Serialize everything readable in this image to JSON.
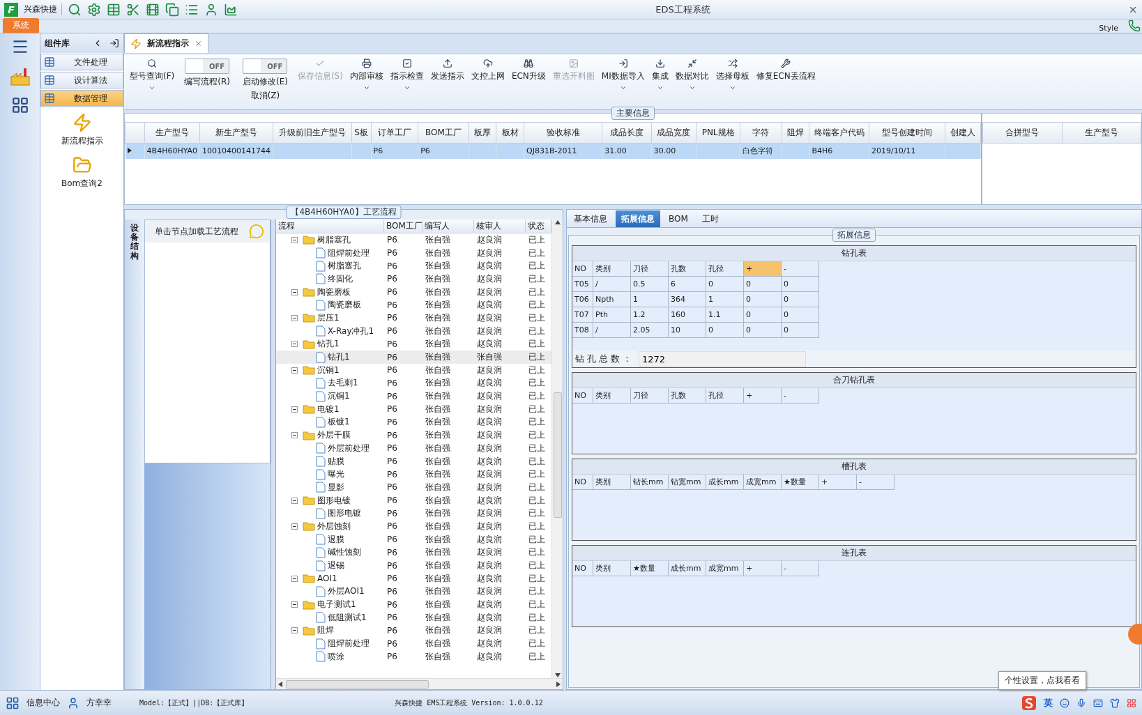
{
  "app": {
    "logo_letter": "F",
    "quick_label": "兴森快捷",
    "title": "EDS工程系统",
    "ribbon_tab": "系统",
    "style_menu": "Style"
  },
  "components": {
    "title": "组件库",
    "items": [
      {
        "label": "文件处理",
        "selected": false
      },
      {
        "label": "设计算法",
        "selected": false
      },
      {
        "label": "数据管理",
        "selected": true
      }
    ],
    "launchers": [
      {
        "label": "新流程指示"
      },
      {
        "label": "Bom查询2"
      }
    ]
  },
  "doc_tab": {
    "label": "新流程指示"
  },
  "toolbar": {
    "items": [
      {
        "kind": "button",
        "label": "型号查询(F)",
        "disabled": false,
        "dropdown": true
      },
      {
        "kind": "toggle",
        "label": "编写流程(R)",
        "switch_text": "OFF",
        "on": false
      },
      {
        "kind": "toggle",
        "label": "启动修改(E)",
        "sub_label": "取消(Z)",
        "switch_text": "OFF",
        "on": false
      },
      {
        "kind": "button",
        "label": "保存信息(S)",
        "disabled": true,
        "dropdown": false
      },
      {
        "kind": "button",
        "label": "内部审核",
        "disabled": false,
        "dropdown": true
      },
      {
        "kind": "button",
        "label": "指示检查",
        "disabled": false,
        "dropdown": true
      },
      {
        "kind": "button",
        "label": "发送指示",
        "disabled": false,
        "dropdown": false
      },
      {
        "kind": "button",
        "label": "文控上网",
        "disabled": false,
        "dropdown": false
      },
      {
        "kind": "button",
        "label": "ECN升级",
        "disabled": false,
        "dropdown": false
      },
      {
        "kind": "button",
        "label": "重选开料图",
        "disabled": true,
        "dropdown": false
      },
      {
        "kind": "button",
        "label": "MI数据导入",
        "disabled": false,
        "dropdown": true
      },
      {
        "kind": "button",
        "label": "集成",
        "disabled": false,
        "dropdown": true
      },
      {
        "kind": "button",
        "label": "数据对比",
        "disabled": false,
        "dropdown": true
      },
      {
        "kind": "button",
        "label": "选择母板",
        "disabled": false,
        "dropdown": true
      },
      {
        "kind": "button",
        "label": "修复ECN丢流程",
        "disabled": false,
        "dropdown": false
      }
    ]
  },
  "main_info": {
    "title": "主要信息",
    "columns": [
      "生产型号",
      "新生产型号",
      "升级前旧生产型号",
      "S板",
      "订单工厂",
      "BOM工厂",
      "板厚",
      "板材",
      "验收标准",
      "成品长度",
      "成品宽度",
      "PNL规格",
      "字符",
      "阻焊",
      "终端客户代码",
      "型号创建时间",
      "创建人"
    ],
    "rows": [
      {
        "selected": true,
        "cells": [
          "4B4H60HYA0",
          "10010400141744",
          "",
          "",
          "P6",
          "P6",
          "",
          "",
          "QJ831B-2011",
          "31.00",
          "30.00",
          "",
          "白色字符",
          "",
          "B4H6",
          "2019/10/11",
          ""
        ]
      }
    ],
    "side_columns": [
      "合拼型号",
      "生产型号"
    ]
  },
  "side_tab": {
    "label": "设备结构"
  },
  "node_panel": {
    "hint": "单击节点加载工艺流程"
  },
  "flow": {
    "title": "【4B4H60HYA0】工艺流程",
    "columns": [
      "流程",
      "BOM工厂",
      "编写人",
      "核审人",
      "状态"
    ],
    "nodes": [
      {
        "name": "树脂塞孔",
        "bom": "P6",
        "writer": "张自强",
        "reviewer": "赵良润",
        "status": "已上",
        "selected": false,
        "expanded": true,
        "children": [
          {
            "name": "阻焊前处理",
            "bom": "P6",
            "writer": "张自强",
            "reviewer": "赵良润",
            "status": "已上",
            "selected": false
          },
          {
            "name": "树脂塞孔",
            "bom": "P6",
            "writer": "张自强",
            "reviewer": "赵良润",
            "status": "已上",
            "selected": false
          },
          {
            "name": "终固化",
            "bom": "P6",
            "writer": "张自强",
            "reviewer": "赵良润",
            "status": "已上",
            "selected": false
          }
        ]
      },
      {
        "name": "陶瓷磨板",
        "bom": "P6",
        "writer": "张自强",
        "reviewer": "赵良润",
        "status": "已上",
        "selected": false,
        "expanded": true,
        "children": [
          {
            "name": "陶瓷磨板",
            "bom": "P6",
            "writer": "张自强",
            "reviewer": "赵良润",
            "status": "已上",
            "selected": false
          }
        ]
      },
      {
        "name": "层压1",
        "bom": "P6",
        "writer": "张自强",
        "reviewer": "赵良润",
        "status": "已上",
        "selected": false,
        "expanded": true,
        "children": [
          {
            "name": "X-Ray冲孔1",
            "bom": "P6",
            "writer": "张自强",
            "reviewer": "赵良润",
            "status": "已上",
            "selected": false
          }
        ]
      },
      {
        "name": "钻孔1",
        "bom": "P6",
        "writer": "张自强",
        "reviewer": "赵良润",
        "status": "已上",
        "selected": false,
        "expanded": true,
        "children": [
          {
            "name": "钻孔1",
            "bom": "P6",
            "writer": "张自强",
            "reviewer": "张自强",
            "status": "已上",
            "selected": true
          }
        ]
      },
      {
        "name": "沉铜1",
        "bom": "P6",
        "writer": "张自强",
        "reviewer": "赵良润",
        "status": "已上",
        "selected": false,
        "expanded": true,
        "children": [
          {
            "name": "去毛刺1",
            "bom": "P6",
            "writer": "张自强",
            "reviewer": "赵良润",
            "status": "已上",
            "selected": false
          },
          {
            "name": "沉铜1",
            "bom": "P6",
            "writer": "张自强",
            "reviewer": "赵良润",
            "status": "已上",
            "selected": false
          }
        ]
      },
      {
        "name": "电镀1",
        "bom": "P6",
        "writer": "张自强",
        "reviewer": "赵良润",
        "status": "已上",
        "selected": false,
        "expanded": true,
        "children": [
          {
            "name": "板镀1",
            "bom": "P6",
            "writer": "张自强",
            "reviewer": "赵良润",
            "status": "已上",
            "selected": false
          }
        ]
      },
      {
        "name": "外层干膜",
        "bom": "P6",
        "writer": "张自强",
        "reviewer": "赵良润",
        "status": "已上",
        "selected": false,
        "expanded": true,
        "children": [
          {
            "name": "外层前处理",
            "bom": "P6",
            "writer": "张自强",
            "reviewer": "赵良润",
            "status": "已上",
            "selected": false
          },
          {
            "name": "贴膜",
            "bom": "P6",
            "writer": "张自强",
            "reviewer": "赵良润",
            "status": "已上",
            "selected": false
          },
          {
            "name": "曝光",
            "bom": "P6",
            "writer": "张自强",
            "reviewer": "赵良润",
            "status": "已上",
            "selected": false
          },
          {
            "name": "显影",
            "bom": "P6",
            "writer": "张自强",
            "reviewer": "赵良润",
            "status": "已上",
            "selected": false
          }
        ]
      },
      {
        "name": "图形电镀",
        "bom": "P6",
        "writer": "张自强",
        "reviewer": "赵良润",
        "status": "已上",
        "selected": false,
        "expanded": true,
        "children": [
          {
            "name": "图形电镀",
            "bom": "P6",
            "writer": "张自强",
            "reviewer": "赵良润",
            "status": "已上",
            "selected": false
          }
        ]
      },
      {
        "name": "外层蚀刻",
        "bom": "P6",
        "writer": "张自强",
        "reviewer": "赵良润",
        "status": "已上",
        "selected": false,
        "expanded": true,
        "children": [
          {
            "name": "退膜",
            "bom": "P6",
            "writer": "张自强",
            "reviewer": "赵良润",
            "status": "已上",
            "selected": false
          },
          {
            "name": "碱性蚀刻",
            "bom": "P6",
            "writer": "张自强",
            "reviewer": "赵良润",
            "status": "已上",
            "selected": false
          },
          {
            "name": "退锡",
            "bom": "P6",
            "writer": "张自强",
            "reviewer": "赵良润",
            "status": "已上",
            "selected": false
          }
        ]
      },
      {
        "name": "AOI1",
        "bom": "P6",
        "writer": "张自强",
        "reviewer": "赵良润",
        "status": "已上",
        "selected": false,
        "expanded": true,
        "children": [
          {
            "name": "外层AOI1",
            "bom": "P6",
            "writer": "张自强",
            "reviewer": "赵良润",
            "status": "已上",
            "selected": false
          }
        ]
      },
      {
        "name": "电子测试1",
        "bom": "P6",
        "writer": "张自强",
        "reviewer": "赵良润",
        "status": "已上",
        "selected": false,
        "expanded": true,
        "children": [
          {
            "name": "低阻测试1",
            "bom": "P6",
            "writer": "张自强",
            "reviewer": "赵良润",
            "status": "已上",
            "selected": false
          }
        ]
      },
      {
        "name": "阻焊",
        "bom": "P6",
        "writer": "张自强",
        "reviewer": "赵良润",
        "status": "已上",
        "selected": false,
        "expanded": true,
        "children": [
          {
            "name": "阻焊前处理",
            "bom": "P6",
            "writer": "张自强",
            "reviewer": "赵良润",
            "status": "已上",
            "selected": false
          },
          {
            "name": "喷涂",
            "bom": "P6",
            "writer": "张自强",
            "reviewer": "赵良润",
            "status": "已上",
            "selected": false
          }
        ]
      }
    ]
  },
  "detail_tabs": [
    {
      "label": "基本信息",
      "selected": false
    },
    {
      "label": "拓展信息",
      "selected": true
    },
    {
      "label": "BOM",
      "selected": false
    },
    {
      "label": "工时",
      "selected": false
    }
  ],
  "extended": {
    "title": "拓展信息",
    "sections": [
      {
        "title": "钻孔表",
        "columns": [
          {
            "label": "NO",
            "selected": false
          },
          {
            "label": "类别",
            "selected": false
          },
          {
            "label": "刀径",
            "selected": false
          },
          {
            "label": "孔数",
            "selected": false
          },
          {
            "label": "孔径",
            "selected": false
          },
          {
            "label": "+",
            "selected": true
          },
          {
            "label": "-",
            "selected": false
          }
        ],
        "rows": [
          [
            "T05",
            "/",
            "0.5",
            "6",
            "0",
            "0",
            "0"
          ],
          [
            "T06",
            "Npth",
            "1",
            "364",
            "1",
            "0",
            "0"
          ],
          [
            "T07",
            "Pth",
            "1.2",
            "160",
            "1.1",
            "0",
            "0"
          ],
          [
            "T08",
            "/",
            "2.05",
            "10",
            "0",
            "0",
            "0"
          ]
        ],
        "total": {
          "label": "钻孔总数：",
          "value": "1272"
        }
      },
      {
        "title": "合刀钻孔表",
        "columns": [
          {
            "label": "NO",
            "selected": false
          },
          {
            "label": "类别",
            "selected": false
          },
          {
            "label": "刀径",
            "selected": false
          },
          {
            "label": "孔数",
            "selected": false
          },
          {
            "label": "孔径",
            "selected": false
          },
          {
            "label": "+",
            "selected": false
          },
          {
            "label": "-",
            "selected": false
          }
        ]
      },
      {
        "title": "槽孔表",
        "columns": [
          {
            "label": "NO",
            "selected": false
          },
          {
            "label": "类别",
            "selected": false
          },
          {
            "label": "钻长mm",
            "selected": false
          },
          {
            "label": "钻宽mm",
            "selected": false
          },
          {
            "label": "成长mm",
            "selected": false
          },
          {
            "label": "成宽mm",
            "selected": false
          },
          {
            "label": "★数量",
            "selected": false
          },
          {
            "label": "+",
            "selected": false
          },
          {
            "label": "-",
            "selected": false
          }
        ]
      },
      {
        "title": "连孔表",
        "columns": [
          {
            "label": "NO",
            "selected": false
          },
          {
            "label": "类别",
            "selected": false
          },
          {
            "label": "★数量",
            "selected": false
          },
          {
            "label": "成长mm",
            "selected": false
          },
          {
            "label": "成宽mm",
            "selected": false
          },
          {
            "label": "+",
            "selected": false
          },
          {
            "label": "-",
            "selected": false
          }
        ]
      }
    ]
  },
  "status_bar": {
    "info_center": "信息中心",
    "user": "方幸幸",
    "env": "Model:【正式】||DB:【正式库】",
    "version": "兴森快捷 EMS工程系统 Version: 1.0.0.12",
    "tooltip": "个性设置，点我看看",
    "ime_mode": "英"
  }
}
